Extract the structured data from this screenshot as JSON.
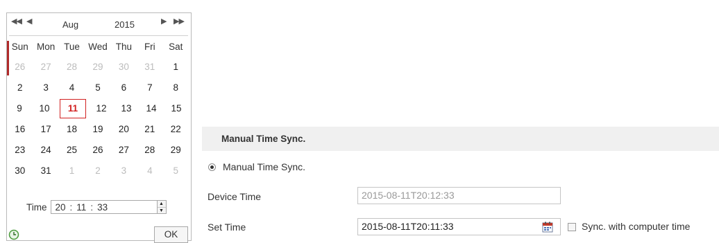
{
  "calendar": {
    "month": "Aug",
    "year": "2015",
    "weekdays": [
      "Sun",
      "Mon",
      "Tue",
      "Wed",
      "Thu",
      "Fri",
      "Sat"
    ],
    "weeks": [
      [
        "26",
        "27",
        "28",
        "29",
        "30",
        "31",
        "1"
      ],
      [
        "2",
        "3",
        "4",
        "5",
        "6",
        "7",
        "8"
      ],
      [
        "9",
        "10",
        "11",
        "12",
        "13",
        "14",
        "15"
      ],
      [
        "16",
        "17",
        "18",
        "19",
        "20",
        "21",
        "22"
      ],
      [
        "23",
        "24",
        "25",
        "26",
        "27",
        "28",
        "29"
      ],
      [
        "30",
        "31",
        "1",
        "2",
        "3",
        "4",
        "5"
      ]
    ],
    "selected_day": "11",
    "time_label": "Time",
    "time": {
      "hour": "20",
      "minute": "11",
      "second": "33"
    },
    "ok_label": "OK",
    "colors": {
      "today": "#d12020",
      "other_month": "#bcbcbc"
    },
    "icons": {
      "prev_year": "double-left-arrow-icon",
      "prev_month": "left-arrow-icon",
      "next_month": "right-arrow-icon",
      "next_year": "double-right-arrow-icon",
      "clock": "clock-icon"
    }
  },
  "manual_sync": {
    "section_title": "Manual Time Sync.",
    "radio_label": "Manual Time Sync.",
    "device_time_label": "Device Time",
    "device_time_value": "2015-08-11T20:12:33",
    "set_time_label": "Set Time",
    "set_time_value": "2015-08-11T20:11:33",
    "sync_checkbox_label": "Sync. with computer time",
    "icons": {
      "date_picker": "calendar-icon"
    }
  }
}
